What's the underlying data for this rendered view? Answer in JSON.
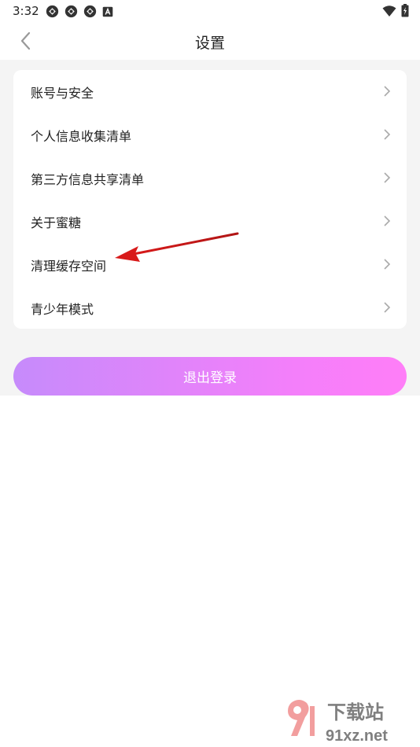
{
  "status_bar": {
    "time": "3:32",
    "notification_icons": [
      "app-notification-icon",
      "app-notification-icon",
      "app-notification-icon",
      "app-a-icon"
    ],
    "right_icons": [
      "wifi-icon",
      "battery-charging-icon"
    ]
  },
  "header": {
    "title": "设置",
    "back_icon": "chevron-left-icon"
  },
  "menu": {
    "items": [
      {
        "label": "账号与安全"
      },
      {
        "label": "个人信息收集清单"
      },
      {
        "label": "第三方信息共享清单"
      },
      {
        "label": "关于蜜糖"
      },
      {
        "label": "清理缓存空间"
      },
      {
        "label": "青少年模式"
      }
    ]
  },
  "logout": {
    "label": "退出登录"
  },
  "annotation": {
    "color": "#e02020",
    "target_item": "清理缓存空间"
  },
  "watermark": {
    "text_top": "下载站",
    "text_bottom": "91xz.net"
  },
  "colors": {
    "gradient_start": "#c68bfb",
    "gradient_end": "#ff7ef8",
    "page_bg": "#f4f4f4"
  }
}
